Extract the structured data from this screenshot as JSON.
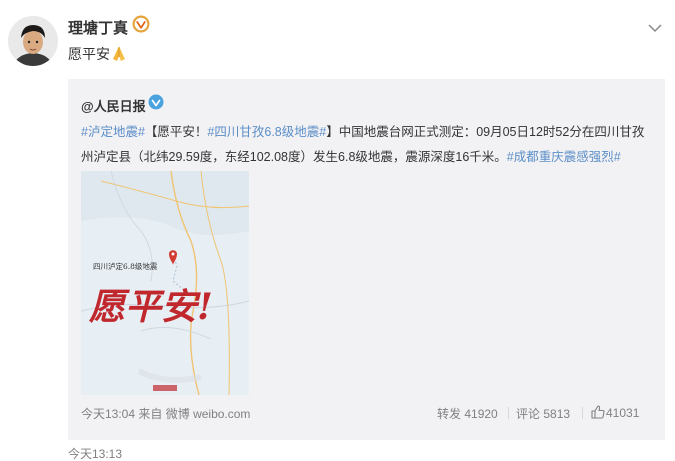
{
  "post": {
    "user_name": "理塘丁真",
    "text": "愿平安",
    "emoji_icon": "folded-hands-emoji",
    "time": "今天13:13"
  },
  "repost": {
    "user_name": "@人民日报",
    "text_segments": [
      {
        "text": "#泸定地震#",
        "tag": true
      },
      {
        "text": "【愿平安！",
        "tag": false
      },
      {
        "text": "#四川甘孜6.8级地震#",
        "tag": true
      },
      {
        "text": "】中国地震台网正式测定：09月05日12时52分在四川甘孜州泸定县（北纬29.59度，东经102.08度）发生6.8级地震，震源深度16千米。",
        "tag": false
      },
      {
        "text": "#成都重庆震感强烈#",
        "tag": true
      }
    ],
    "image": {
      "map_label": "四川泸定6.8级地震",
      "calligraphy": "愿平安!"
    },
    "time": "今天13:04",
    "source_prefix": "来自",
    "source": "微博 weibo.com",
    "repost_label": "转发",
    "repost_count": "41920",
    "comment_label": "评论",
    "comment_count": "5813",
    "like_count": "41031"
  },
  "colors": {
    "tag": "#5b8ec7",
    "verified_badge": "#e6a23c",
    "verified_blue": "#4aa3df",
    "calligraphy": "#c0282d"
  }
}
